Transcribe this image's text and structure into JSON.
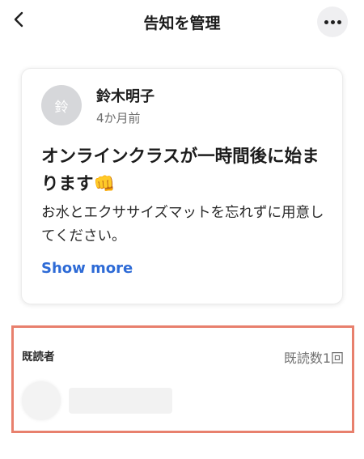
{
  "header": {
    "title": "告知を管理",
    "back_icon": "chevron-left-icon",
    "more_icon": "more-horizontal-icon"
  },
  "post": {
    "author_initial": "鈴",
    "author_name": "鈴木明子",
    "time_ago": "4か月前",
    "title": "オンラインクラスが一時間後に始まります👊",
    "body": "お水とエクササイズマットを忘れずに用意してください。",
    "show_more": "Show more"
  },
  "readers": {
    "label": "既読者",
    "count_text": "既読数1回",
    "highlight_color": "#e8806d"
  },
  "colors": {
    "link": "#2e6bd6",
    "avatar_bg": "#d6d7da"
  }
}
